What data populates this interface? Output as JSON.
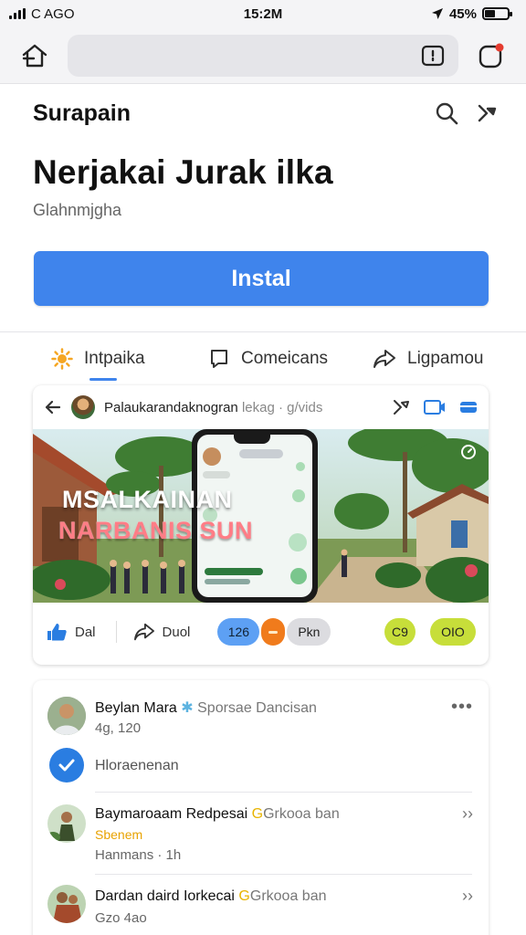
{
  "status_bar": {
    "carrier": "C AGO",
    "time": "15:2M",
    "battery": "45%",
    "battery_level": 0.45
  },
  "browser": {
    "back_icon": "home-icon",
    "tab_icon": "tab-switcher-icon",
    "notification_icon": "notification-icon"
  },
  "header": {
    "title": "Surapain"
  },
  "app": {
    "name": "Nerjakai Jurak ilka",
    "developer": "Glahnmjgha",
    "install_label": "Instal"
  },
  "tabs": [
    {
      "label": "Intpaika",
      "icon": "sun-icon"
    },
    {
      "label": "Comeicans",
      "icon": "comment-icon"
    },
    {
      "label": "Ligpamou",
      "icon": "share-icon"
    }
  ],
  "post": {
    "author": "Palaukarandaknogran",
    "meta": " lekag · g/vids",
    "media_line1": "MSALKAINAN",
    "media_line2": "NARBANIS SUN",
    "like_label": "Dal",
    "share_label": "Duol",
    "badge1": "126",
    "badge3": "Pkn",
    "badge4": "C9",
    "badge5": "OIO",
    "colors": {
      "badge_blue": "#5da0f4",
      "badge_orange": "#f07b1c",
      "badge_gray": "#dcdce0",
      "badge_lime": "#c7de3a"
    }
  },
  "comments": [
    {
      "name": "Beylan Mara",
      "tag": " Sporsae Dancisan",
      "sub": "4g, 120"
    },
    {
      "verified_label": "Hloraenenan"
    },
    {
      "name": "Baymaroaam Redpesai",
      "tag": "Grkooa ban",
      "sub_orange": "Sbenem",
      "sub": "Hanmans · 1h"
    },
    {
      "name": "Dardan daird Iorkecai",
      "tag": "Grkooa ban",
      "sub": "Gzo 4ao"
    }
  ]
}
